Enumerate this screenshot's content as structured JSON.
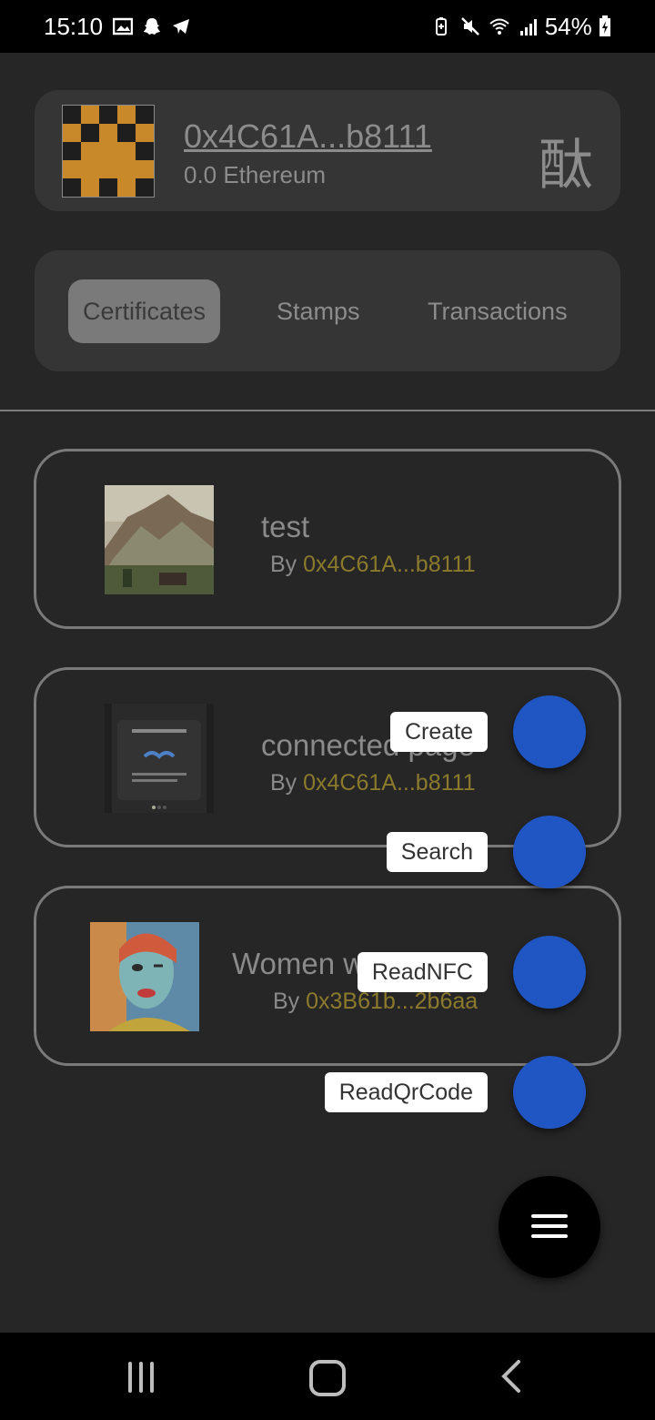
{
  "status_bar": {
    "time": "15:10",
    "battery": "54%",
    "left_icons": [
      "gallery-icon",
      "snapchat-icon",
      "telegram-icon"
    ],
    "right_icons": [
      "battery-saver-icon",
      "mute-icon",
      "wifi-icon",
      "signal-icon",
      "battery-icon"
    ]
  },
  "wallet": {
    "address": "0x4C61A...b8111",
    "balance": "0.0 Ethereum",
    "kanji": "酞"
  },
  "tabs": [
    {
      "label": "Certificates",
      "active": true
    },
    {
      "label": "Stamps",
      "active": false
    },
    {
      "label": "Transactions",
      "active": false
    }
  ],
  "certificates": [
    {
      "title": "test",
      "by_label": "By ",
      "owner": "0x4C61A...b8111",
      "thumb": "mountain-painting"
    },
    {
      "title": "connected page",
      "by_label": "By ",
      "owner": "0x4C61A...b8111",
      "thumb": "wallet-connect-screenshot"
    },
    {
      "title": "Women with colors",
      "by_label": "By ",
      "owner": "0x3B61b...2b6aa",
      "thumb": "woman-portrait-painting"
    }
  ],
  "fab_menu": {
    "actions": [
      {
        "label": "Create"
      },
      {
        "label": "Search"
      },
      {
        "label": "ReadNFC"
      },
      {
        "label": "ReadQrCode"
      }
    ],
    "main_icon": "menu-icon"
  },
  "colors": {
    "background": "#262626",
    "card": "#353535",
    "fab_action": "#1f56c3",
    "owner_text": "#8b7a2c"
  },
  "nav_bar": {
    "icons": [
      "recents-icon",
      "home-icon",
      "back-icon"
    ]
  }
}
